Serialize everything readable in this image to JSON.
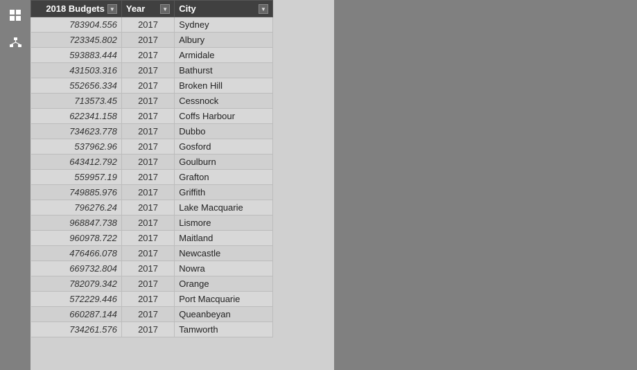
{
  "header": {
    "col1_label": "2018 Budgets",
    "col2_label": "Year",
    "col3_label": "City"
  },
  "rows": [
    {
      "budget": "783904.556",
      "year": "2017",
      "city": "Sydney"
    },
    {
      "budget": "723345.802",
      "year": "2017",
      "city": "Albury"
    },
    {
      "budget": "593883.444",
      "year": "2017",
      "city": "Armidale"
    },
    {
      "budget": "431503.316",
      "year": "2017",
      "city": "Bathurst"
    },
    {
      "budget": "552656.334",
      "year": "2017",
      "city": "Broken Hill"
    },
    {
      "budget": "713573.45",
      "year": "2017",
      "city": "Cessnock"
    },
    {
      "budget": "622341.158",
      "year": "2017",
      "city": "Coffs Harbour"
    },
    {
      "budget": "734623.778",
      "year": "2017",
      "city": "Dubbo"
    },
    {
      "budget": "537962.96",
      "year": "2017",
      "city": "Gosford"
    },
    {
      "budget": "643412.792",
      "year": "2017",
      "city": "Goulburn"
    },
    {
      "budget": "559957.19",
      "year": "2017",
      "city": "Grafton"
    },
    {
      "budget": "749885.976",
      "year": "2017",
      "city": "Griffith"
    },
    {
      "budget": "796276.24",
      "year": "2017",
      "city": "Lake Macquarie"
    },
    {
      "budget": "968847.738",
      "year": "2017",
      "city": "Lismore"
    },
    {
      "budget": "960978.722",
      "year": "2017",
      "city": "Maitland"
    },
    {
      "budget": "476466.078",
      "year": "2017",
      "city": "Newcastle"
    },
    {
      "budget": "669732.804",
      "year": "2017",
      "city": "Nowra"
    },
    {
      "budget": "782079.342",
      "year": "2017",
      "city": "Orange"
    },
    {
      "budget": "572229.446",
      "year": "2017",
      "city": "Port Macquarie"
    },
    {
      "budget": "660287.144",
      "year": "2017",
      "city": "Queanbeyan"
    },
    {
      "budget": "734261.576",
      "year": "2017",
      "city": "Tamworth"
    }
  ],
  "icons": {
    "grid_icon": "⊞",
    "hierarchy_icon": "⊡"
  }
}
